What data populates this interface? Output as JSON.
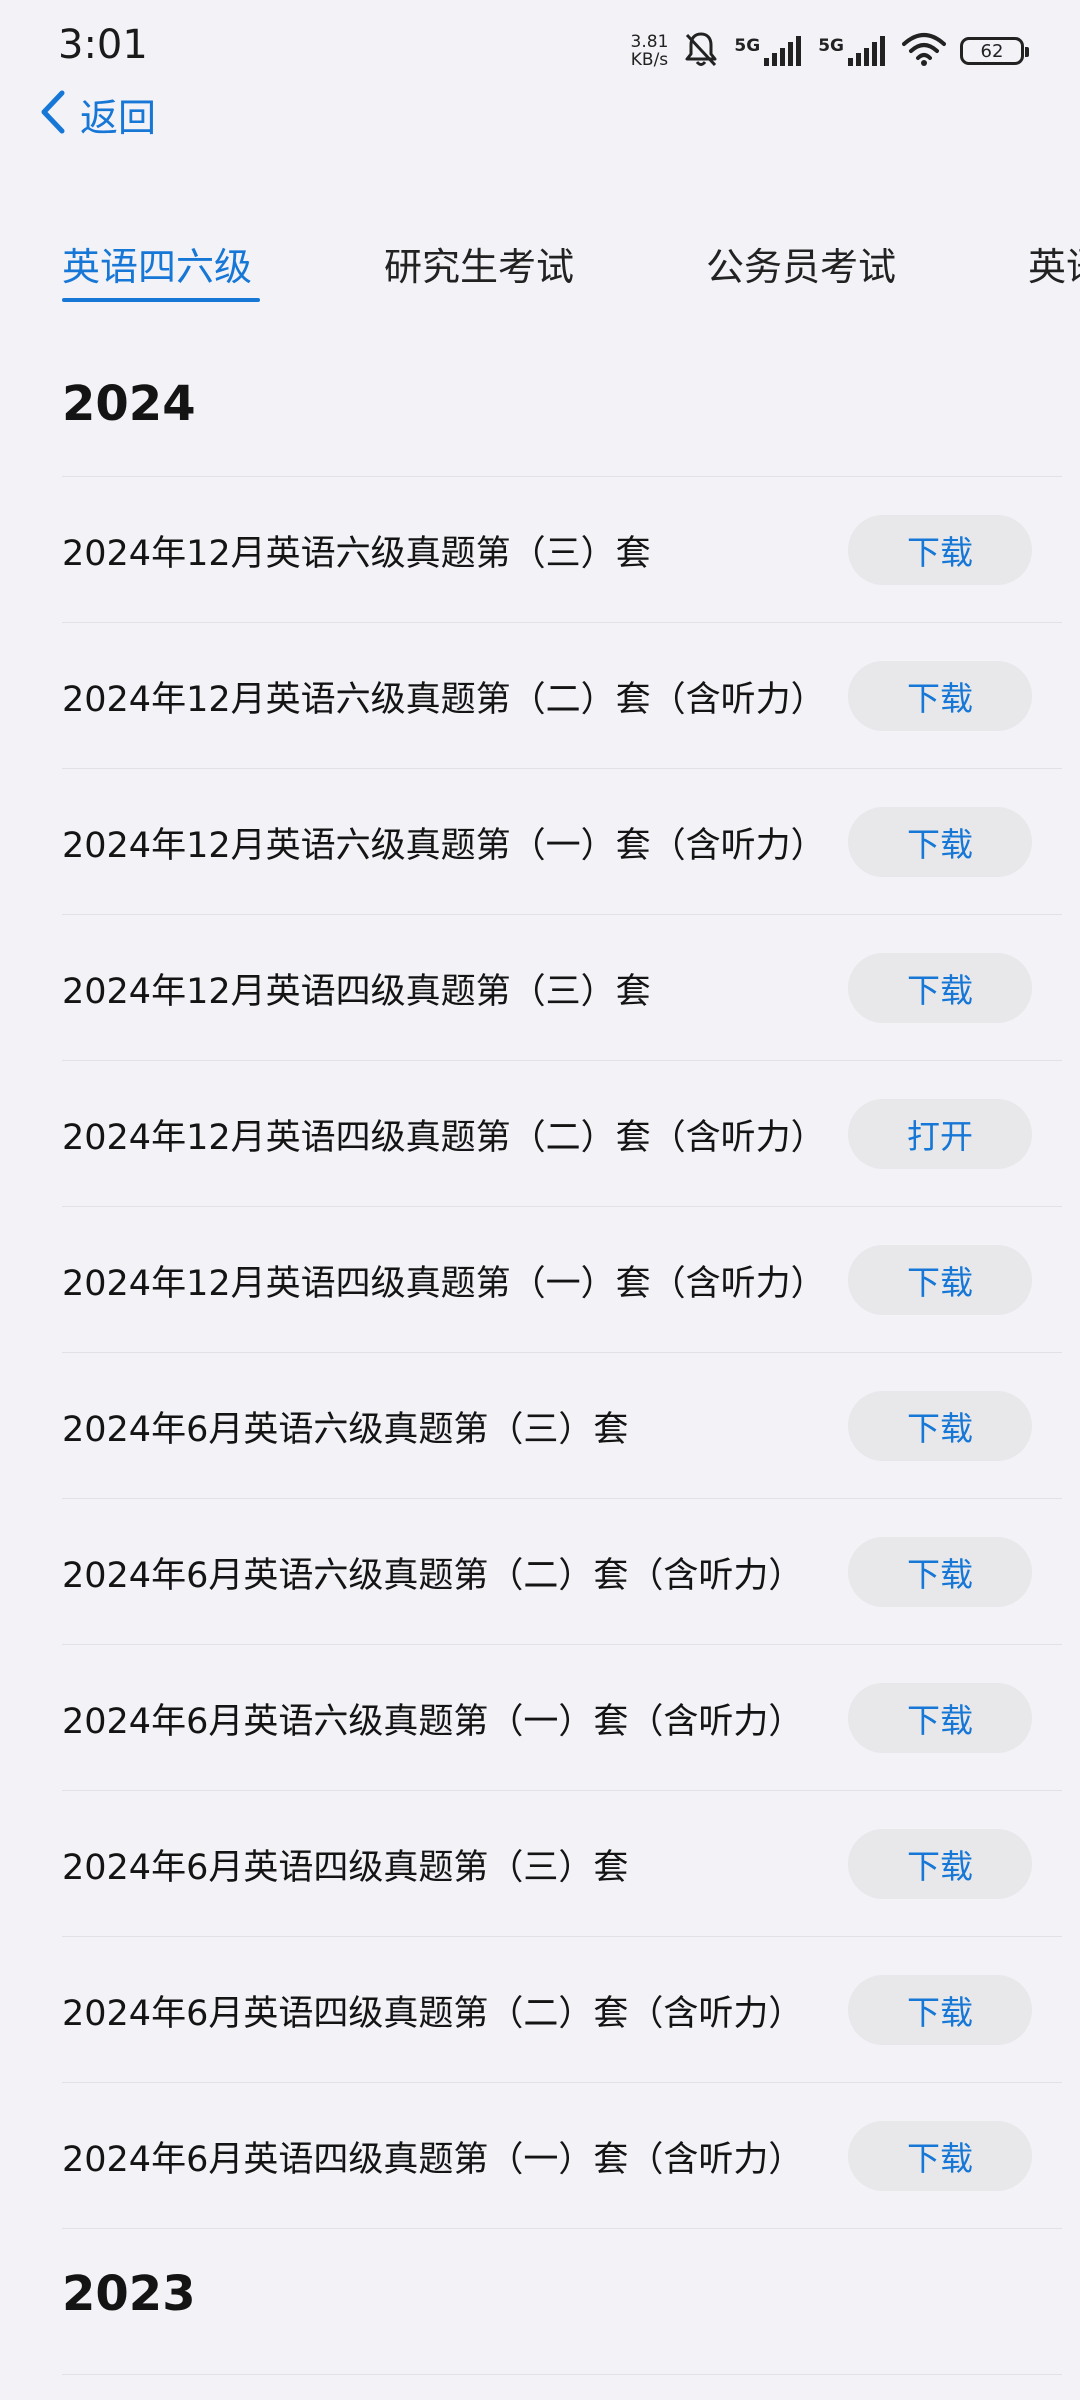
{
  "status_bar": {
    "time": "3:01",
    "net_speed_value": "3.81",
    "net_speed_unit": "KB/s",
    "signal1_label": "5G",
    "signal2_label": "5G",
    "battery": "62"
  },
  "nav": {
    "back_label": "返回"
  },
  "tabs": [
    {
      "label": "英语四六级",
      "active": true
    },
    {
      "label": "研究生考试",
      "active": false
    },
    {
      "label": "公务员考试",
      "active": false
    },
    {
      "label": "英语",
      "active": false
    }
  ],
  "sections": [
    {
      "year": "2024",
      "items": [
        {
          "title": "2024年12月英语六级真题第（三）套",
          "action": "下载"
        },
        {
          "title": "2024年12月英语六级真题第（二）套（含听力）",
          "action": "下载"
        },
        {
          "title": "2024年12月英语六级真题第（一）套（含听力）",
          "action": "下载"
        },
        {
          "title": "2024年12月英语四级真题第（三）套",
          "action": "下载"
        },
        {
          "title": "2024年12月英语四级真题第（二）套（含听力）",
          "action": "打开"
        },
        {
          "title": "2024年12月英语四级真题第（一）套（含听力）",
          "action": "下载"
        },
        {
          "title": "2024年6月英语六级真题第（三）套",
          "action": "下载"
        },
        {
          "title": "2024年6月英语六级真题第（二）套（含听力）",
          "action": "下载"
        },
        {
          "title": "2024年6月英语六级真题第（一）套（含听力）",
          "action": "下载"
        },
        {
          "title": "2024年6月英语四级真题第（三）套",
          "action": "下载"
        },
        {
          "title": "2024年6月英语四级真题第（二）套（含听力）",
          "action": "下载"
        },
        {
          "title": "2024年6月英语四级真题第（一）套（含听力）",
          "action": "下载"
        }
      ]
    },
    {
      "year": "2023",
      "items": []
    }
  ],
  "colors": {
    "accent": "#1677d6",
    "background": "#f2f2f7",
    "button_bg": "#e8e8eb"
  }
}
